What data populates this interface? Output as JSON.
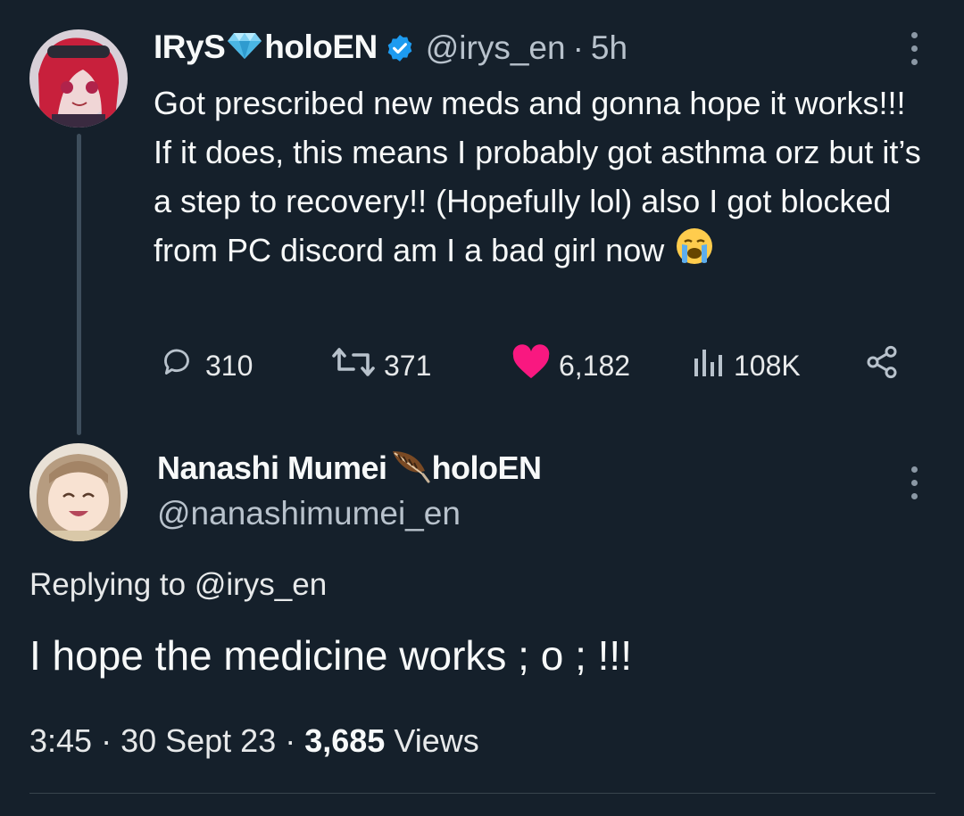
{
  "tweet": {
    "author_name_part1": "IRyS",
    "author_name_part2": "holoEN",
    "handle": "@irys_en",
    "separator": "·",
    "time": "5h",
    "text": "Got prescribed new meds and gonna hope it works!!! If it does, this means I probably got asthma orz but it’s a step to recovery!! (Hopefully lol) also I got blocked from PC discord am I a bad girl now ",
    "stats": {
      "replies": "310",
      "retweets": "371",
      "likes": "6,182",
      "views": "108K"
    },
    "icons": [
      "diamond-emoji",
      "verified-badge-icon",
      "crying-face-emoji",
      "reply-icon",
      "retweet-icon",
      "heart-icon",
      "views-icon",
      "share-icon",
      "more-icon"
    ]
  },
  "reply": {
    "author_name_part1": "Nanashi Mumei",
    "author_name_part2": "holoEN",
    "handle": "@nanashimumei_en",
    "replying_prefix": "Replying to ",
    "replying_handle": "@irys_en",
    "text": "I hope the medicine works ; o ; !!!",
    "time": "3:45",
    "sep1": " · ",
    "date": "30 Sept 23",
    "sep2": " · ",
    "views_count": "3,685",
    "views_label": " Views",
    "icons": [
      "feather-emoji",
      "more-icon"
    ]
  },
  "colors": {
    "background": "#15202b",
    "text": "#f7f9f9",
    "secondary": "#b8c2cc",
    "like": "#f91880",
    "verified": "#1d9bf0",
    "thread_line": "#3e4e5c"
  }
}
